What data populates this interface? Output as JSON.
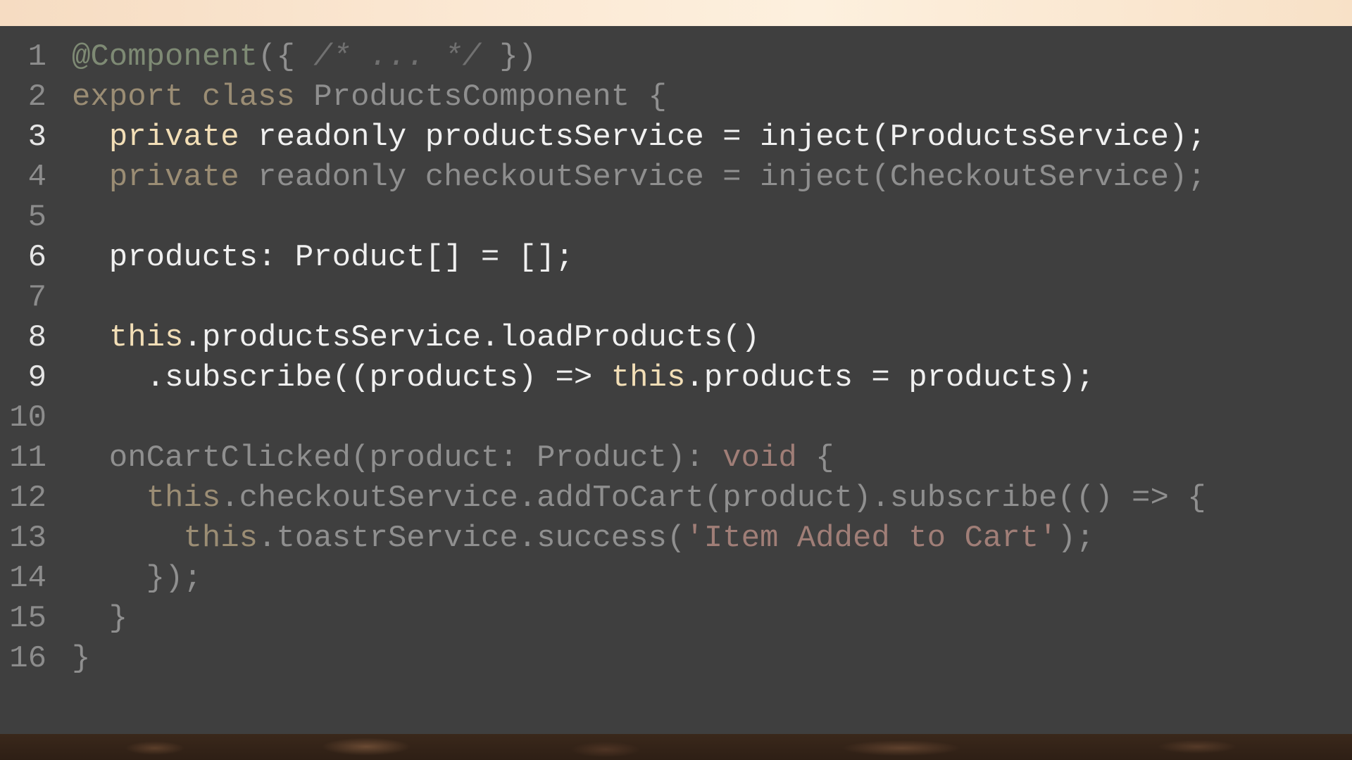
{
  "editor": {
    "lines": [
      {
        "num": "1",
        "focused": false,
        "tokens": [
          {
            "t": "@Component",
            "c": "dimdec"
          },
          {
            "t": "({ ",
            "c": "dim"
          },
          {
            "t": "/* ... */",
            "c": "dimcm"
          },
          {
            "t": " })",
            "c": "dim"
          }
        ]
      },
      {
        "num": "2",
        "focused": false,
        "tokens": [
          {
            "t": "export class ",
            "c": "dimkw"
          },
          {
            "t": "ProductsComponent {",
            "c": "dim"
          }
        ]
      },
      {
        "num": "3",
        "focused": true,
        "tokens": [
          {
            "t": "  ",
            "c": "fg"
          },
          {
            "t": "private",
            "c": "kw"
          },
          {
            "t": " readonly productsService = inject(ProductsService);",
            "c": "fg"
          }
        ]
      },
      {
        "num": "4",
        "focused": false,
        "tokens": [
          {
            "t": "  ",
            "c": "dim"
          },
          {
            "t": "private",
            "c": "dimkw"
          },
          {
            "t": " readonly checkoutService = inject(CheckoutService);",
            "c": "dim"
          }
        ]
      },
      {
        "num": "5",
        "focused": false,
        "tokens": []
      },
      {
        "num": "6",
        "focused": true,
        "tokens": [
          {
            "t": "  products: Product[] = [];",
            "c": "fg"
          }
        ]
      },
      {
        "num": "7",
        "focused": false,
        "tokens": []
      },
      {
        "num": "8",
        "focused": true,
        "tokens": [
          {
            "t": "  ",
            "c": "fg"
          },
          {
            "t": "this",
            "c": "kw"
          },
          {
            "t": ".productsService.loadProducts()",
            "c": "fg"
          }
        ]
      },
      {
        "num": "9",
        "focused": true,
        "tokens": [
          {
            "t": "    .subscribe((products) => ",
            "c": "fg"
          },
          {
            "t": "this",
            "c": "kw"
          },
          {
            "t": ".products = products);",
            "c": "fg"
          }
        ]
      },
      {
        "num": "10",
        "focused": false,
        "tokens": []
      },
      {
        "num": "11",
        "focused": false,
        "tokens": [
          {
            "t": "  onCartClicked(product: Product): ",
            "c": "dim"
          },
          {
            "t": "void",
            "c": "dimstr"
          },
          {
            "t": " {",
            "c": "dim"
          }
        ]
      },
      {
        "num": "12",
        "focused": false,
        "tokens": [
          {
            "t": "    ",
            "c": "dim"
          },
          {
            "t": "this",
            "c": "dimkw"
          },
          {
            "t": ".checkoutService.addToCart(product).subscribe(() => {",
            "c": "dim"
          }
        ]
      },
      {
        "num": "13",
        "focused": false,
        "tokens": [
          {
            "t": "      ",
            "c": "dim"
          },
          {
            "t": "this",
            "c": "dimkw"
          },
          {
            "t": ".toastrService.success(",
            "c": "dim"
          },
          {
            "t": "'Item Added to Cart'",
            "c": "dimstr"
          },
          {
            "t": ");",
            "c": "dim"
          }
        ]
      },
      {
        "num": "14",
        "focused": false,
        "tokens": [
          {
            "t": "    });",
            "c": "dim"
          }
        ]
      },
      {
        "num": "15",
        "focused": false,
        "tokens": [
          {
            "t": "  }",
            "c": "dim"
          }
        ]
      },
      {
        "num": "16",
        "focused": false,
        "tokens": [
          {
            "t": "}",
            "c": "dim"
          }
        ]
      }
    ]
  },
  "colors": {
    "panel_background": "#3f3f3f",
    "focused_text": "#f0f0f0",
    "focused_keyword": "#f2deb6",
    "dimmed_text": "#8f8f8f",
    "dimmed_string": "#a07e77"
  }
}
